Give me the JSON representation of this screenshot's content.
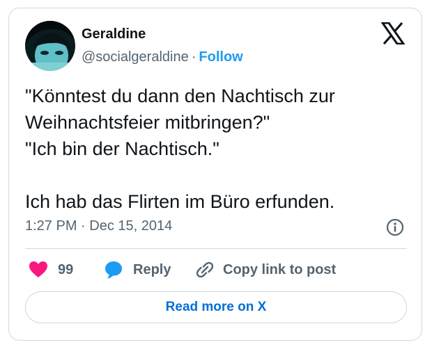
{
  "author": {
    "display_name": "Geraldine",
    "handle": "@socialgeraldine",
    "separator": "·",
    "follow_label": "Follow"
  },
  "tweet": {
    "lines": [
      "\"Könntest du dann den Nachtisch zur",
      "Weihnachtsfeier mitbringen?\"",
      "\"Ich bin der Nachtisch.\"",
      "",
      "Ich hab das Flirten im Büro erfunden."
    ],
    "timestamp": "1:27 PM · Dec 15, 2014"
  },
  "actions": {
    "like_count": "99",
    "reply_label": "Reply",
    "copy_link_label": "Copy link to post"
  },
  "footer": {
    "read_more_label": "Read more on X"
  },
  "icons": {
    "logo": "x-logo-icon",
    "info": "info-icon",
    "like": "heart-icon",
    "reply": "speech-bubble-icon",
    "copy": "link-icon"
  },
  "colors": {
    "like": "#f91880",
    "reply": "#1d9bf0",
    "follow": "#1d9bf0",
    "read_more": "#006fd6",
    "muted": "#536471",
    "border": "#cfd9de"
  }
}
